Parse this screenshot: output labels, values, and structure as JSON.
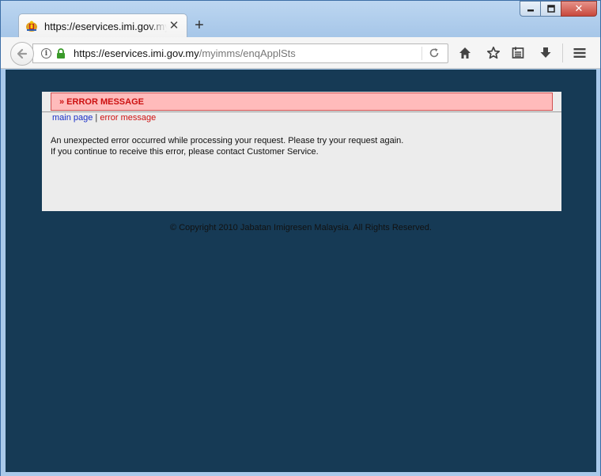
{
  "browser": {
    "tab_title": "https://eservices.imi.gov.my/",
    "tab_close": "✕",
    "new_tab": "+",
    "url_host": "https://eservices.imi.gov.my",
    "url_path": "/myimms/enqApplSts",
    "window_controls": {
      "minimize": "▬",
      "maximize": "▢",
      "close": "✕"
    },
    "icons": [
      "back-arrow-icon",
      "site-info-icon",
      "padlock-icon",
      "reload-icon",
      "home-icon",
      "bookmark-star-icon",
      "reading-list-icon",
      "download-icon",
      "hamburger-menu-icon"
    ]
  },
  "page": {
    "error_banner": "» ERROR MESSAGE",
    "breadcrumb": {
      "main": "main page",
      "sep": " | ",
      "current": "error message"
    },
    "error_line1": "An unexpected error occurred while processing your request. Please try your request again.",
    "error_line2": "If you continue to receive this error, please contact Customer Service.",
    "copyright": "© Copyright 2010 Jabatan Imigresen Malaysia. All Rights Reserved."
  },
  "colors": {
    "page_background": "#163a55",
    "banner_background": "#ffbbbb",
    "banner_text": "#cc1010",
    "link_blue": "#1a2fc8"
  }
}
